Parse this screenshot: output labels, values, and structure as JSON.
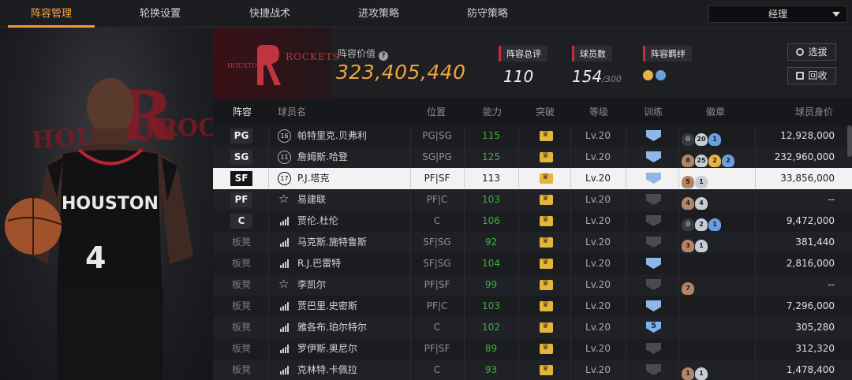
{
  "tabs": [
    "阵容管理",
    "轮换设置",
    "快捷战术",
    "进攻策略",
    "防守策略"
  ],
  "manager": "经理",
  "art": {
    "word1": "HOUSTON",
    "word2": "ROCKE",
    "jersey_text": "HOUSTON",
    "jersey_number": "4"
  },
  "team": {
    "logo_text": "ROCKETS",
    "logo_city": "HOUSTON",
    "value_label": "阵容价值",
    "value": "323,405,440"
  },
  "stats": {
    "rating_label": "阵容总评",
    "rating": "110",
    "players_label": "球员数",
    "players": "154",
    "players_cap": "/300",
    "bond_label": "阵容羁绊"
  },
  "buttons": {
    "sign": "选拔",
    "recall": "回收"
  },
  "columns": [
    "阵容",
    "球员名",
    "位置",
    "能力",
    "突破",
    "等级",
    "训练",
    "徽章",
    "球员身价"
  ],
  "rows": [
    {
      "slot": "PG",
      "icon": "num",
      "num": "16",
      "name": "帕特里克.贝弗利",
      "pos": "PG|SG",
      "ability": "115",
      "green": true,
      "level": "Lv.20",
      "train": "blue",
      "badges": [
        [
          "d",
          "0"
        ],
        [
          "s",
          "20"
        ],
        [
          "h",
          "1"
        ]
      ],
      "worth": "12,928,000"
    },
    {
      "slot": "SG",
      "icon": "num",
      "num": "11",
      "name": "詹姆斯.哈登",
      "pos": "SG|PG",
      "ability": "125",
      "green": true,
      "level": "Lv.20",
      "train": "blue",
      "badges": [
        [
          "b",
          "8"
        ],
        [
          "s",
          "25"
        ],
        [
          "g",
          "2"
        ],
        [
          "h",
          "2"
        ]
      ],
      "worth": "232,960,000"
    },
    {
      "slot": "SF",
      "icon": "num",
      "num": "17",
      "name": "P.J.塔克",
      "pos": "PF|SF",
      "ability": "113",
      "green": false,
      "level": "Lv.20",
      "train": "blue",
      "badges": [
        [
          "b",
          "5"
        ],
        [
          "s",
          "1"
        ]
      ],
      "worth": "33,856,000"
    },
    {
      "slot": "PF",
      "icon": "star",
      "num": "",
      "name": "易建联",
      "pos": "PF|C",
      "ability": "103",
      "green": true,
      "level": "Lv.20",
      "train": "grey",
      "badges": [
        [
          "b",
          "4"
        ],
        [
          "s",
          "4"
        ]
      ],
      "worth": "--"
    },
    {
      "slot": "C",
      "icon": "bar",
      "num": "",
      "name": "贾伦.杜伦",
      "pos": "C",
      "ability": "106",
      "green": true,
      "level": "Lv.20",
      "train": "grey",
      "badges": [
        [
          "d",
          "0"
        ],
        [
          "s",
          "2"
        ],
        [
          "h",
          "1"
        ]
      ],
      "worth": "9,472,000"
    },
    {
      "slot": "板凳",
      "icon": "bar",
      "num": "",
      "name": "马克斯.施特鲁斯",
      "pos": "SF|SG",
      "ability": "92",
      "green": true,
      "level": "Lv.20",
      "train": "grey",
      "badges": [
        [
          "b",
          "3"
        ],
        [
          "s",
          "1"
        ]
      ],
      "worth": "381,440"
    },
    {
      "slot": "板凳",
      "icon": "bar",
      "num": "",
      "name": "R.J.巴雷特",
      "pos": "SF|SG",
      "ability": "104",
      "green": true,
      "level": "Lv.20",
      "train": "blue",
      "badges": [],
      "worth": "2,816,000"
    },
    {
      "slot": "板凳",
      "icon": "star",
      "num": "",
      "name": "李凯尔",
      "pos": "PF|SF",
      "ability": "99",
      "green": true,
      "level": "Lv.20",
      "train": "grey",
      "badges": [
        [
          "b",
          "7"
        ]
      ],
      "worth": "--"
    },
    {
      "slot": "板凳",
      "icon": "bar",
      "num": "",
      "name": "贾巴里.史密斯",
      "pos": "PF|C",
      "ability": "103",
      "green": true,
      "level": "Lv.20",
      "train": "blue",
      "badges": [],
      "worth": "7,296,000"
    },
    {
      "slot": "板凳",
      "icon": "bar",
      "num": "",
      "name": "雅各布.珀尔特尔",
      "pos": "C",
      "ability": "102",
      "green": true,
      "level": "Lv.20",
      "train": "num5",
      "badges": [],
      "worth": "305,280"
    },
    {
      "slot": "板凳",
      "icon": "bar",
      "num": "",
      "name": "罗伊斯.奥尼尔",
      "pos": "PF|SF",
      "ability": "89",
      "green": true,
      "level": "Lv.20",
      "train": "grey",
      "badges": [],
      "worth": "312,320"
    },
    {
      "slot": "板凳",
      "icon": "bar",
      "num": "",
      "name": "克林特.卡佩拉",
      "pos": "C",
      "ability": "93",
      "green": true,
      "level": "Lv.20",
      "train": "grey",
      "badges": [
        [
          "b",
          "1"
        ],
        [
          "s",
          "1"
        ]
      ],
      "worth": "1,478,400"
    }
  ],
  "colors": {
    "accent": "#f09a3a",
    "red": "#c23038",
    "green": "#3fae41"
  }
}
